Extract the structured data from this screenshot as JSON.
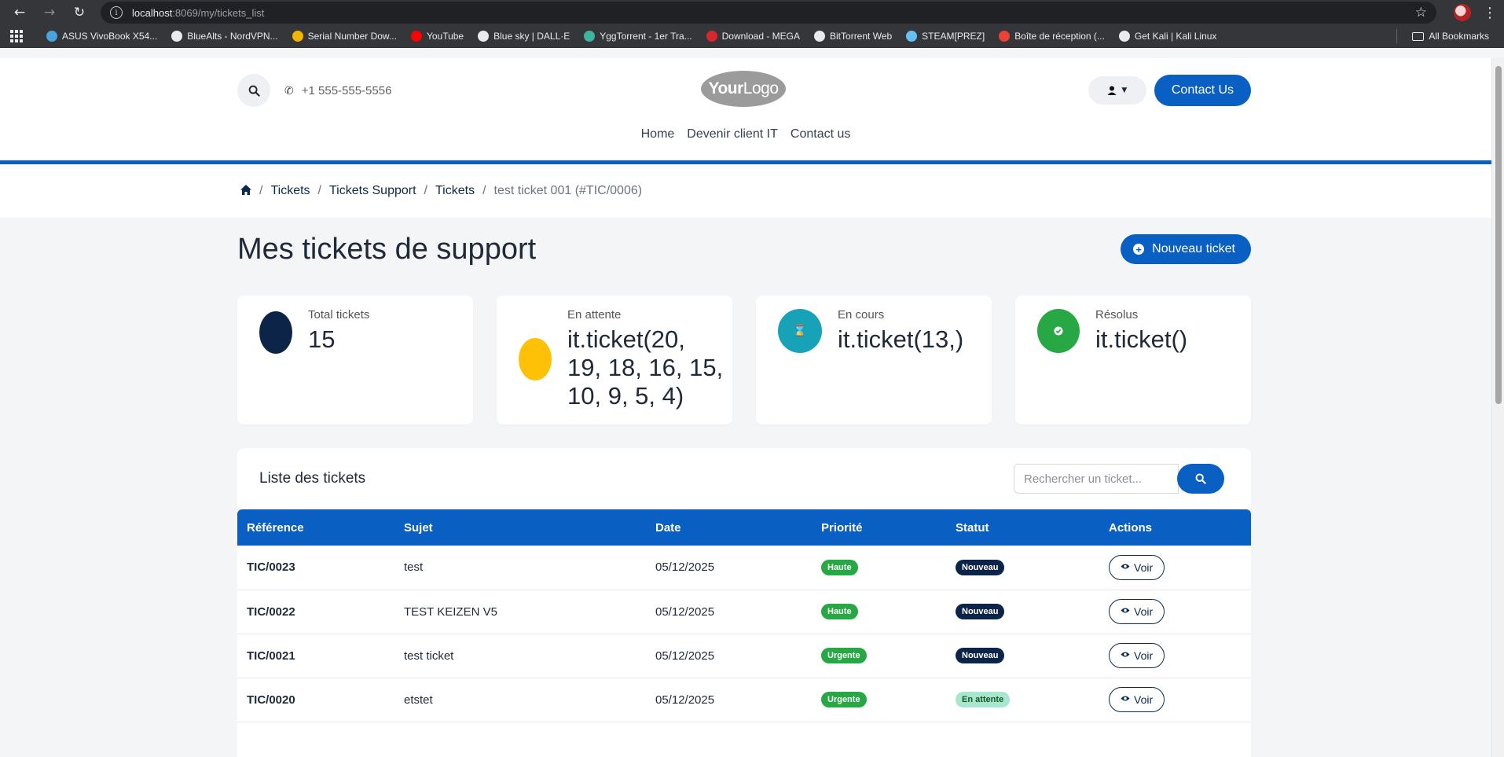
{
  "browser": {
    "url_host": "localhost",
    "url_path": ":8069/my/tickets_list",
    "bookmarks": [
      {
        "label": "ASUS VivoBook X54...",
        "color": "#4aa3df"
      },
      {
        "label": "BlueAlts - NordVPN...",
        "color": "#e8eaed"
      },
      {
        "label": "Serial Number Dow...",
        "color": "#f0b400"
      },
      {
        "label": "YouTube",
        "color": "#ff0000"
      },
      {
        "label": "Blue sky | DALL·E",
        "color": "#e8eaed"
      },
      {
        "label": "YggTorrent - 1er Tra...",
        "color": "#3fb5a0"
      },
      {
        "label": "Download - MEGA",
        "color": "#d9272e"
      },
      {
        "label": "BitTorrent Web",
        "color": "#e8eaed"
      },
      {
        "label": "STEAM[PREZ]",
        "color": "#66c0f4"
      },
      {
        "label": "Boîte de réception (...",
        "color": "#ea4335"
      },
      {
        "label": "Get Kali | Kali Linux",
        "color": "#e8eaed"
      }
    ],
    "all_bookmarks": "All Bookmarks"
  },
  "header": {
    "phone": "+1 555-555-5556",
    "logo_your": "Your",
    "logo_logo": "Logo",
    "contact_button": "Contact Us",
    "nav": [
      "Home",
      "Devenir client IT",
      "Contact us"
    ]
  },
  "breadcrumb": {
    "items": [
      "Tickets",
      "Tickets Support",
      "Tickets"
    ],
    "current": "test ticket 001 (#TIC/0006)"
  },
  "page": {
    "title": "Mes tickets de support",
    "new_ticket_button": "Nouveau ticket"
  },
  "stats": [
    {
      "label": "Total tickets",
      "value": "15",
      "color": "#0b2447"
    },
    {
      "label": "En attente",
      "value": "it.ticket(20, 19, 18, 16, 15, 10, 9, 5, 4)",
      "color": "#ffc107"
    },
    {
      "label": "En cours",
      "value": "it.ticket(13,)",
      "color": "#17a2b8"
    },
    {
      "label": "Résolus",
      "value": "it.ticket()",
      "color": "#28a745"
    }
  ],
  "list": {
    "title": "Liste des tickets",
    "search_placeholder": "Rechercher un ticket...",
    "columns": [
      "Référence",
      "Sujet",
      "Date",
      "Priorité",
      "Statut",
      "Actions"
    ],
    "action_label": "Voir",
    "rows": [
      {
        "ref": "TIC/0023",
        "subject": "test",
        "date": "05/12/2025",
        "priority": "Haute",
        "status": "Nouveau"
      },
      {
        "ref": "TIC/0022",
        "subject": "TEST KEIZEN V5",
        "date": "05/12/2025",
        "priority": "Haute",
        "status": "Nouveau"
      },
      {
        "ref": "TIC/0021",
        "subject": "test ticket",
        "date": "05/12/2025",
        "priority": "Urgente",
        "status": "Nouveau"
      },
      {
        "ref": "TIC/0020",
        "subject": "etstet",
        "date": "05/12/2025",
        "priority": "Urgente",
        "status": "En attente"
      }
    ]
  },
  "colors": {
    "primary": "#0a5fc2",
    "navy": "#0b2447",
    "priority_green": "#28a745",
    "status_nouveau": "#0b2447",
    "status_attente_bg": "#a8e6cf",
    "status_attente_fg": "#155724"
  }
}
